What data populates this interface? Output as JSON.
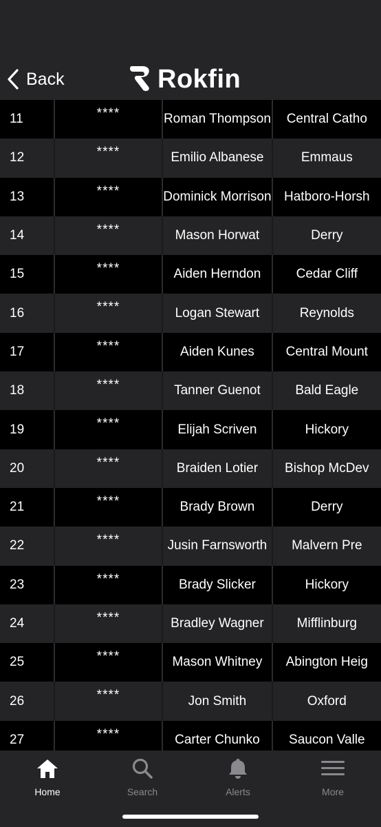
{
  "header": {
    "back_label": "Back",
    "logo_text": "Rokfin"
  },
  "rows": [
    {
      "rank": "11",
      "stars": "****",
      "name": "Roman Thompson",
      "school": "Central Catho"
    },
    {
      "rank": "12",
      "stars": "****",
      "name": "Emilio Albanese",
      "school": "Emmaus"
    },
    {
      "rank": "13",
      "stars": "****",
      "name": "Dominick Morrison",
      "school": "Hatboro-Horsh"
    },
    {
      "rank": "14",
      "stars": "****",
      "name": "Mason Horwat",
      "school": "Derry"
    },
    {
      "rank": "15",
      "stars": "****",
      "name": "Aiden Herndon",
      "school": "Cedar Cliff"
    },
    {
      "rank": "16",
      "stars": "****",
      "name": "Logan Stewart",
      "school": "Reynolds"
    },
    {
      "rank": "17",
      "stars": "****",
      "name": "Aiden Kunes",
      "school": "Central Mount"
    },
    {
      "rank": "18",
      "stars": "****",
      "name": "Tanner Guenot",
      "school": "Bald Eagle"
    },
    {
      "rank": "19",
      "stars": "****",
      "name": "Elijah Scriven",
      "school": "Hickory"
    },
    {
      "rank": "20",
      "stars": "****",
      "name": "Braiden Lotier",
      "school": "Bishop McDev"
    },
    {
      "rank": "21",
      "stars": "****",
      "name": "Brady Brown",
      "school": "Derry"
    },
    {
      "rank": "22",
      "stars": "****",
      "name": "Jusin Farnsworth",
      "school": "Malvern Pre"
    },
    {
      "rank": "23",
      "stars": "****",
      "name": "Brady Slicker",
      "school": "Hickory"
    },
    {
      "rank": "24",
      "stars": "****",
      "name": "Bradley Wagner",
      "school": "Mifflinburg"
    },
    {
      "rank": "25",
      "stars": "****",
      "name": "Mason Whitney",
      "school": "Abington Heig"
    },
    {
      "rank": "26",
      "stars": "****",
      "name": "Jon Smith",
      "school": "Oxford"
    },
    {
      "rank": "27",
      "stars": "****",
      "name": "Carter Chunko",
      "school": "Saucon Valle"
    }
  ],
  "tabbar": {
    "tabs": [
      {
        "label": "Home",
        "icon": "home-icon",
        "active": true
      },
      {
        "label": "Search",
        "icon": "search-icon",
        "active": false
      },
      {
        "label": "Alerts",
        "icon": "bell-icon",
        "active": false
      },
      {
        "label": "More",
        "icon": "hamburger-menu-icon",
        "active": false
      }
    ]
  },
  "colors": {
    "background": "#1c1c1e",
    "row_dark": "#000000",
    "row_light": "#242426",
    "tab_inactive": "#8a8a8e",
    "text": "#ffffff"
  }
}
